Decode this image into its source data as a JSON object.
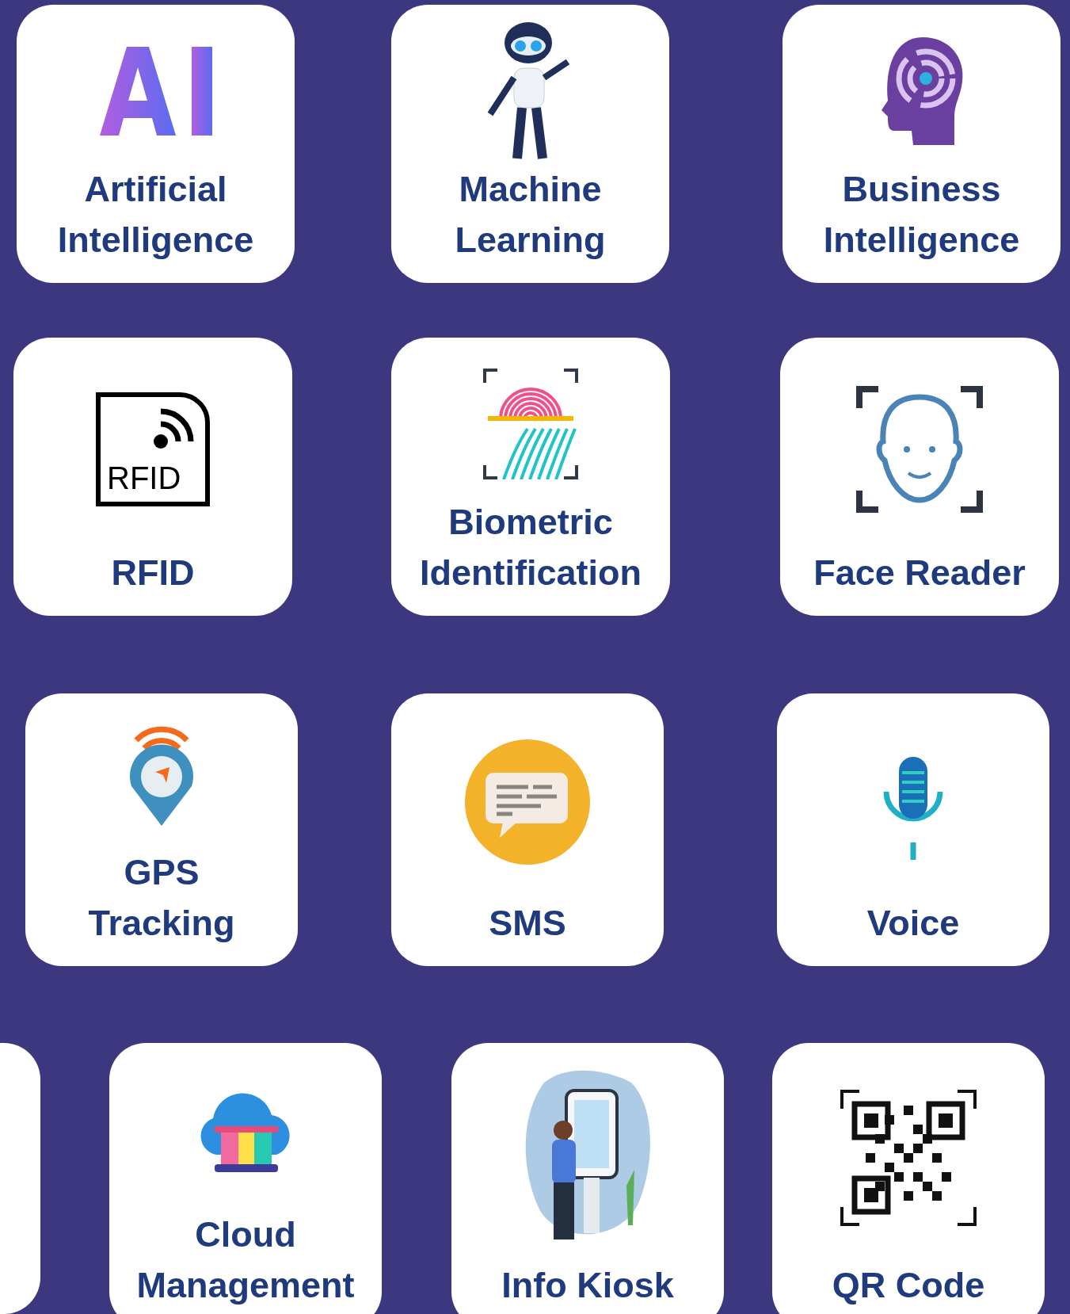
{
  "rows": [
    {
      "cards": [
        {
          "kind": "ai",
          "title": "Artificial\nIntelligence"
        },
        {
          "kind": "robot",
          "title": "Machine\nLearning"
        },
        {
          "kind": "brain",
          "title": "Business\nIntelligence"
        }
      ]
    },
    {
      "cards": [
        {
          "kind": "rfid",
          "title": "RFID",
          "icon_text": "RFID"
        },
        {
          "kind": "fingerprint",
          "title": "Biometric\nIdentification"
        },
        {
          "kind": "face",
          "title": "Face Reader"
        }
      ]
    },
    {
      "cards": [
        {
          "kind": "gps",
          "title": "GPS\nTracking"
        },
        {
          "kind": "sms",
          "title": "SMS"
        },
        {
          "kind": "voice",
          "title": "Voice"
        }
      ]
    },
    {
      "cards": [
        {
          "kind": "cloud",
          "title": "Cloud\nManagement"
        },
        {
          "kind": "kiosk",
          "title": "Info Kiosk"
        },
        {
          "kind": "qr",
          "title": "QR Code"
        }
      ]
    }
  ]
}
